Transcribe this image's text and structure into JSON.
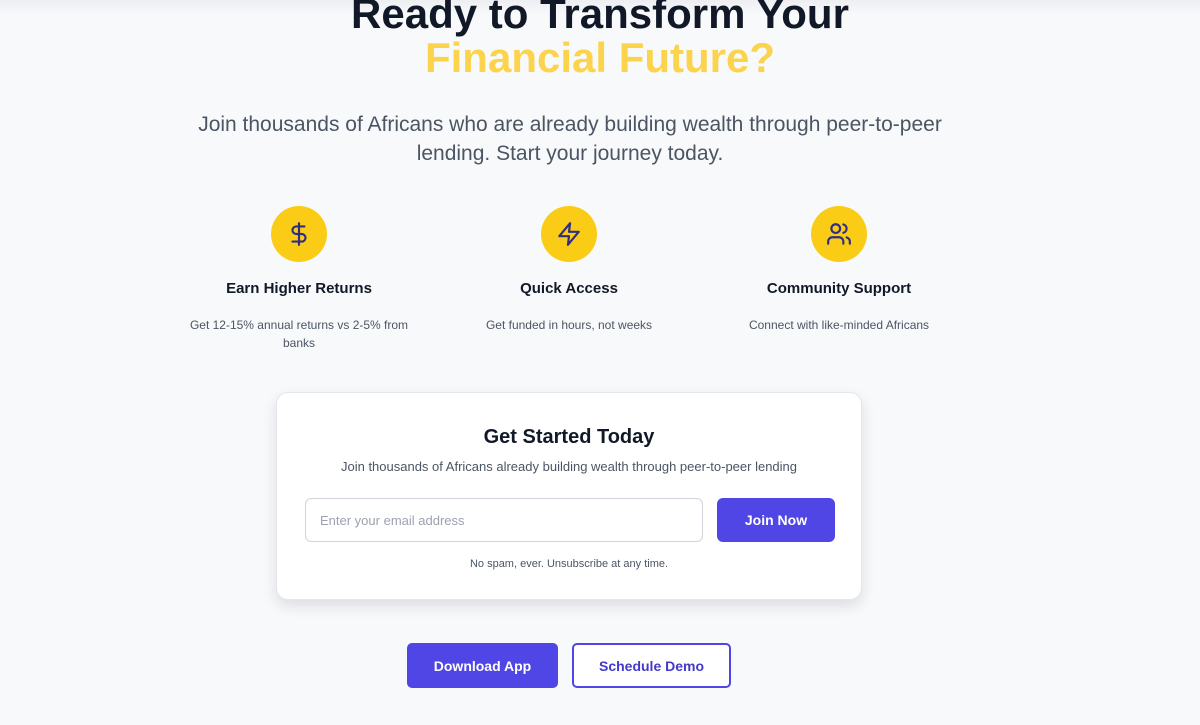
{
  "hero": {
    "title_line1": "Ready to Transform Your",
    "title_line2": "Financial Future?",
    "subtitle": "Join thousands of Africans who are already building wealth through peer-to-peer lending. Start your journey today."
  },
  "features": [
    {
      "icon": "dollar-icon",
      "title": "Earn Higher Returns",
      "description": "Get 12-15% annual returns vs 2-5% from banks"
    },
    {
      "icon": "lightning-icon",
      "title": "Quick Access",
      "description": "Get funded in hours, not weeks"
    },
    {
      "icon": "users-icon",
      "title": "Community Support",
      "description": "Connect with like-minded Africans"
    }
  ],
  "signup": {
    "title": "Get Started Today",
    "subtitle": "Join thousands of Africans already building wealth through peer-to-peer lending",
    "email_placeholder": "Enter your email address",
    "email_value": "",
    "button_label": "Join Now",
    "note": "No spam, ever. Unsubscribe at any time."
  },
  "cta": {
    "primary_label": "Download App",
    "secondary_label": "Schedule Demo"
  },
  "colors": {
    "accent": "#4f46e5",
    "highlight": "#facc15",
    "headline_highlight": "#fcd34d",
    "text_dark": "#111827",
    "text_muted": "#4b5563"
  }
}
